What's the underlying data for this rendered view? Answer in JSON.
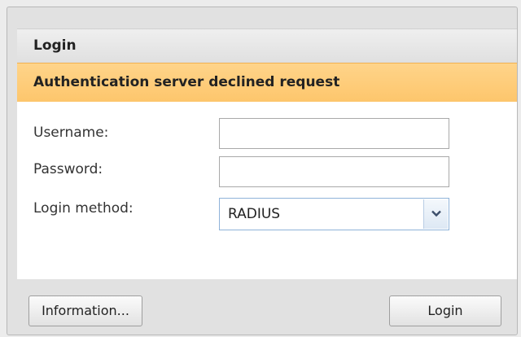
{
  "dialog": {
    "title": "Login",
    "alert_message": "Authentication server declined request"
  },
  "form": {
    "username_label": "Username:",
    "username_value": "",
    "password_label": "Password:",
    "password_value": "",
    "login_method_label": "Login method:",
    "login_method_value": "RADIUS"
  },
  "buttons": {
    "information_label": "Information...",
    "login_label": "Login"
  },
  "colors": {
    "alert_background": "#fdc66c",
    "dialog_background": "#e1e1e1"
  },
  "icons": {
    "dropdown_arrow": "chevron-down-icon"
  }
}
